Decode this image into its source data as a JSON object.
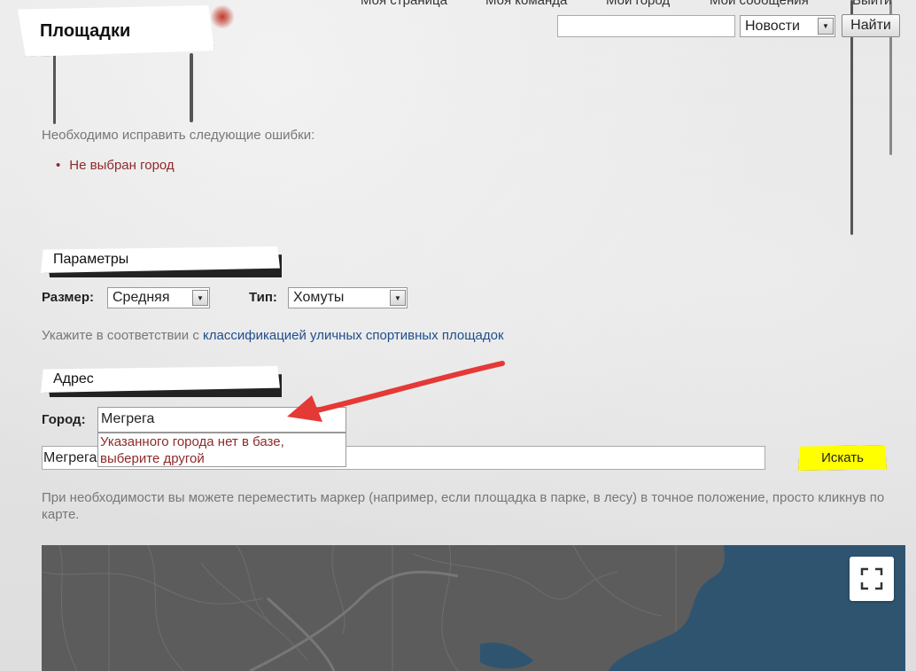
{
  "nav": {
    "links": [
      "Моя страница",
      "Моя команда",
      "Мой город",
      "Мои сообщения",
      "Выйти"
    ]
  },
  "search": {
    "query": "",
    "category": "Новости",
    "button": "Найти"
  },
  "page": {
    "title": "Площадки"
  },
  "errors": {
    "intro": "Необходимо исправить следующие ошибки:",
    "items": [
      "Не выбран город"
    ]
  },
  "params": {
    "section_title": "Параметры",
    "size_label": "Размер:",
    "size_value": "Средняя",
    "type_label": "Тип:",
    "type_value": "Хомуты",
    "hint_prefix": "Укажите в соответствии с",
    "hint_link": "классификацией уличных спортивных площадок"
  },
  "address": {
    "section_title": "Адрес",
    "city_label": "Город:",
    "city_value": "Мегрега",
    "city_suggest_line1": "Указанного города нет в базе,",
    "city_suggest_line2": "выберите другой",
    "address_value": "Мегрега",
    "search_button": "Искать",
    "marker_hint": "При необходимости вы можете переместить маркер (например, если площадка в парке, в лесу) в точное положение, просто кликнув по карте."
  },
  "colors": {
    "accent_yellow": "#ffff00",
    "error_red": "#8e2a2a",
    "link_blue": "#1f4e8c",
    "annotation_arrow": "#e53935",
    "map_land": "#5c5c5c",
    "map_water": "#2f5470"
  },
  "icons": {
    "fullscreen": "fullscreen-icon",
    "dropdown": "chevron-down-icon"
  }
}
